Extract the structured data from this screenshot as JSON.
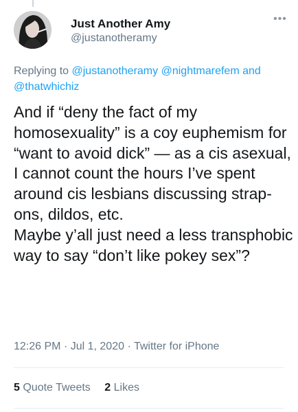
{
  "tweet": {
    "author": {
      "name": "Just Another Amy",
      "handle": "@justanotheramy"
    },
    "more_icon": "more-horizontal-icon",
    "reply": {
      "prefix": "Replying to ",
      "mentions": [
        "@justanotheramy",
        "@nightmarefem",
        "and",
        "@thatwhichiz"
      ]
    },
    "text": {
      "paragraph_1": "And if “deny the fact of my homosexuality” is a coy euphemism for “want to avoid dick” — as a cis asexual, I cannot count the hours I’ve spent around cis lesbians discussing strap-ons, dildos, etc.",
      "paragraph_2": "Maybe y’all just need a less transphobic way to say “don’t like pokey sex”?"
    },
    "meta": {
      "time": "12:26 PM",
      "date": "Jul 1, 2020",
      "source": "Twitter for iPhone"
    },
    "stats": {
      "quote_tweets_count": "5",
      "quote_tweets_label": "Quote Tweets",
      "likes_count": "2",
      "likes_label": "Likes"
    }
  },
  "colors": {
    "text": "#14171a",
    "secondary": "#657786",
    "link": "#1da1f2",
    "divider": "#e6ecf0"
  }
}
